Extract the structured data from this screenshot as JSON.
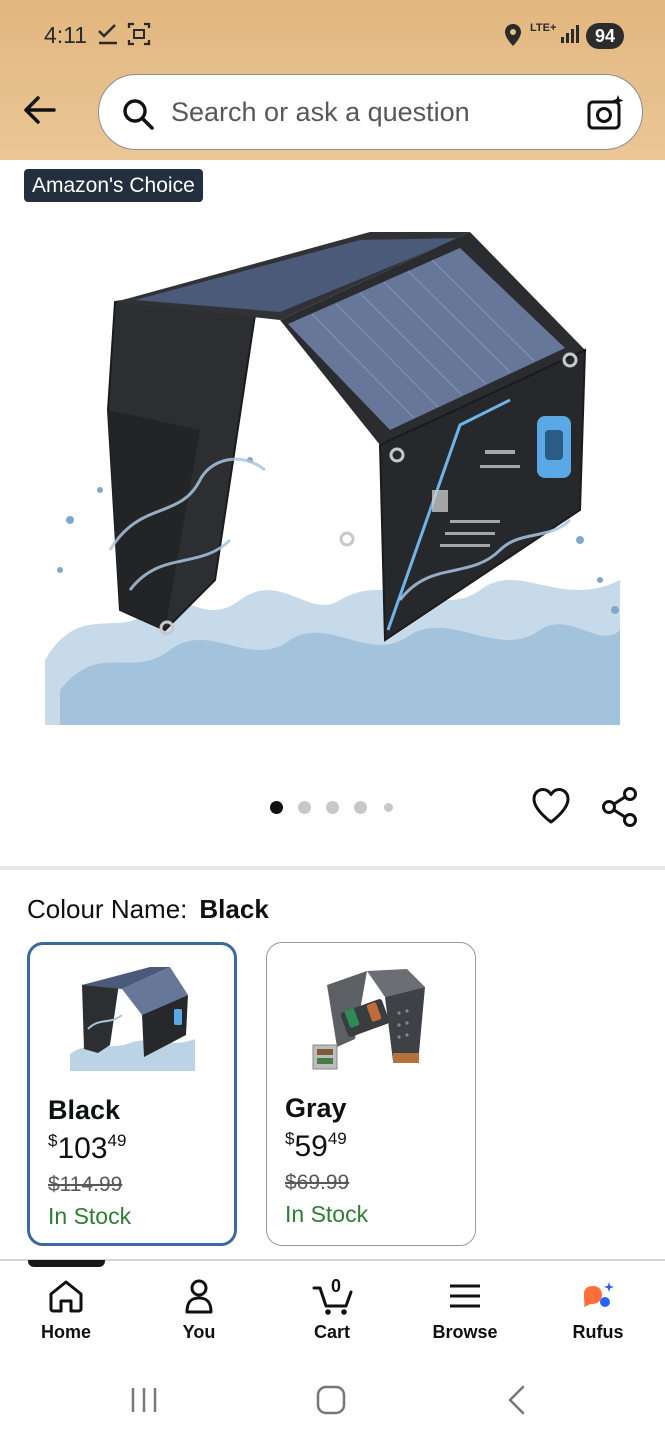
{
  "status_bar": {
    "time": "4:11",
    "network": "LTE+",
    "battery": "94"
  },
  "header": {
    "search_placeholder": "Search or ask a question"
  },
  "product": {
    "badge": "Amazon's Choice",
    "gallery_pages": 5,
    "gallery_active_index": 0
  },
  "colour": {
    "label": "Colour Name:",
    "selected": "Black",
    "options": [
      {
        "name": "Black",
        "price_symbol": "$",
        "price_whole": "103",
        "price_cents": "49",
        "was": "$114.99",
        "stock": "In Stock",
        "selected": true
      },
      {
        "name": "Gray",
        "price_symbol": "$",
        "price_whole": "59",
        "price_cents": "49",
        "was": "$69.99",
        "stock": "In Stock",
        "selected": false
      }
    ]
  },
  "bottom_nav": {
    "items": [
      {
        "label": "Home",
        "icon": "home-icon"
      },
      {
        "label": "You",
        "icon": "person-icon"
      },
      {
        "label": "Cart",
        "icon": "cart-icon",
        "count": "0"
      },
      {
        "label": "Browse",
        "icon": "menu-icon"
      },
      {
        "label": "Rufus",
        "icon": "rufus-icon"
      }
    ],
    "active_index": 0
  },
  "colors": {
    "header_bg": "#e6bf8b",
    "badge_bg": "#232f3e",
    "selected_border": "#3a6aa0",
    "in_stock": "#2e7d32"
  }
}
